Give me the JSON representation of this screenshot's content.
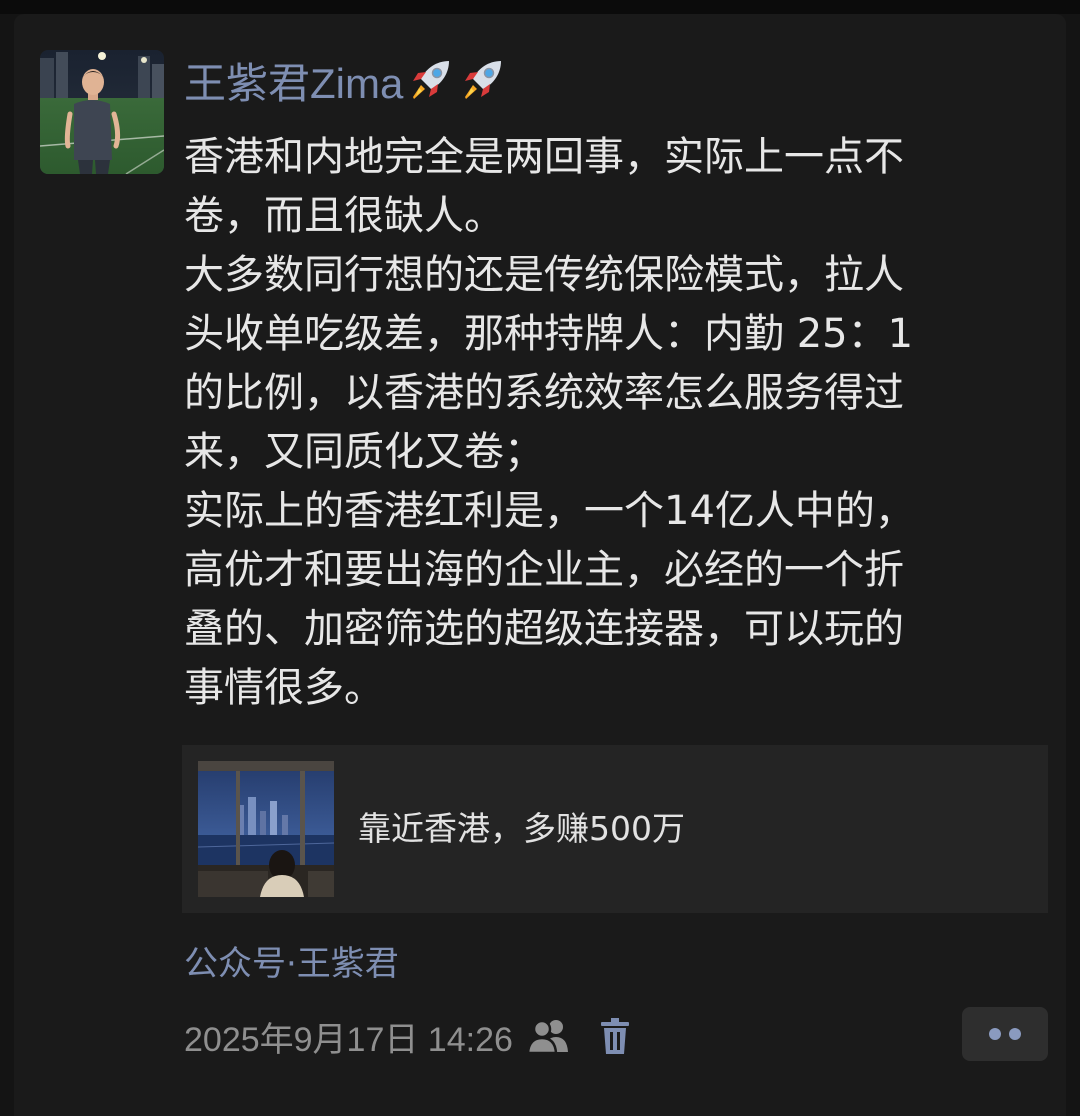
{
  "post": {
    "author": "王紫君Zima",
    "author_emoji": [
      "rocket-icon",
      "rocket-icon"
    ],
    "lines": [
      "香港和内地完全是两回事，实际上一点不",
      "卷，而且很缺人。",
      "大多数同行想的还是传统保险模式，拉人",
      "头收单吃级差，那种持牌人：内勤 25：1",
      "的比例，以香港的系统效率怎么服务得过",
      "来，又同质化又卷；",
      "实际上的香港红利是，一个14亿人中的，",
      "高优才和要出海的企业主，必经的一个折",
      "叠的、加密筛选的超级连接器，可以玩的",
      "事情很多。"
    ]
  },
  "link_card": {
    "title": "靠近香港，多赚500万"
  },
  "source": {
    "label": "公众号·王紫君"
  },
  "meta": {
    "timestamp": "2025年9月17日 14:26",
    "icons": [
      "friends-visibility-icon",
      "trash-icon",
      "more-dots-icon"
    ]
  },
  "colors": {
    "background": "#1a1a1a",
    "author_link": "#7e8eb2",
    "body_text": "#e7e7e7",
    "card_background": "#242424",
    "timestamp": "#8f8f8f"
  }
}
